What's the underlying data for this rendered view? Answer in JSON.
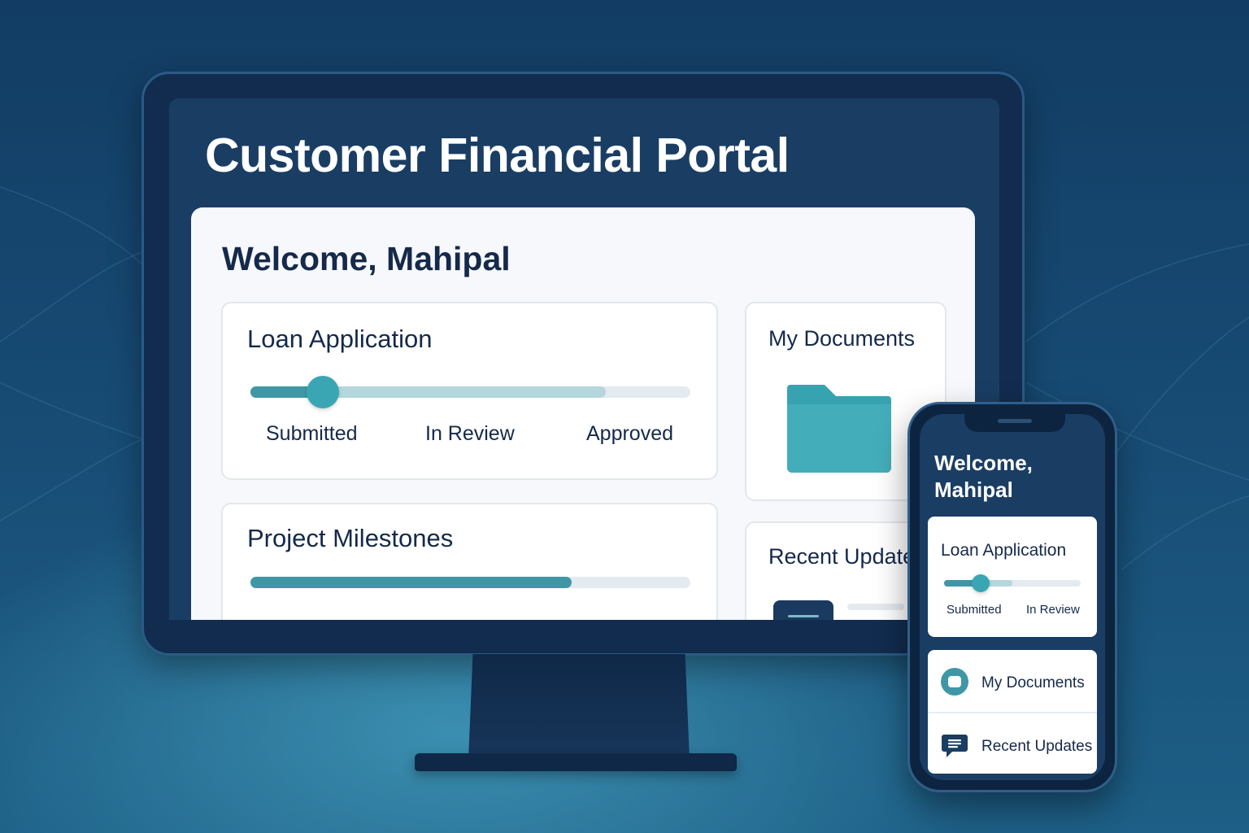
{
  "colors": {
    "background": "#184d76",
    "screen": "#1a3d63",
    "accent": "#3f97a6",
    "text_dark": "#15294a"
  },
  "desktop": {
    "title": "Customer Financial Portal",
    "welcome": "Welcome, Mahipal",
    "loan_card": {
      "title": "Loan Application",
      "steps": [
        "Submitted",
        "In Review",
        "Approved"
      ],
      "current_step": "Submitted"
    },
    "milestones_card": {
      "title": "Project Milestones",
      "progress_fraction": 0.73
    },
    "documents_card": {
      "title": "My Documents",
      "icon": "folder-icon"
    },
    "updates_card": {
      "title": "Recent Update"
    },
    "dock_icon": "menu-icon"
  },
  "mobile": {
    "welcome_line1": "Welcome,",
    "welcome_line2": "Mahipal",
    "loan_card": {
      "title": "Loan Application",
      "steps": [
        "Submitted",
        "In Review"
      ]
    },
    "menu": [
      {
        "label": "My Documents",
        "icon": "document-icon"
      },
      {
        "label": "Recent Updates",
        "icon": "chat-icon"
      }
    ]
  }
}
